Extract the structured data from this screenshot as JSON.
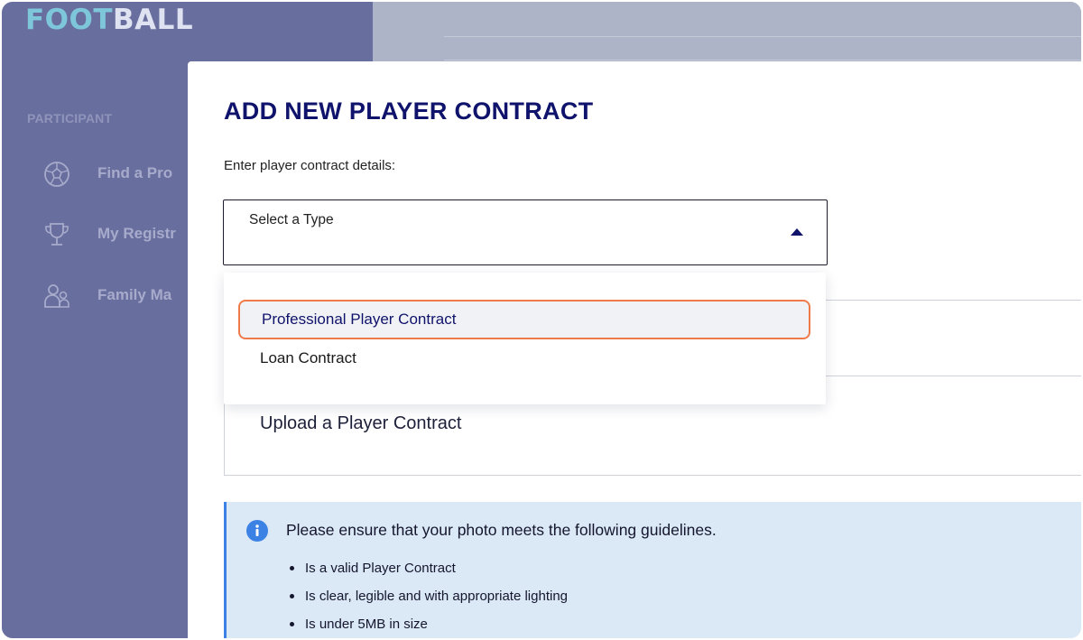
{
  "logo": {
    "part1": "FOOT",
    "part2": "BALL"
  },
  "sidebar": {
    "section_label": "PARTICIPANT",
    "items": [
      {
        "label": "Find a Pro",
        "icon": "soccer-ball-icon"
      },
      {
        "label": "My Registr",
        "icon": "trophy-icon"
      },
      {
        "label": "Family Ma",
        "icon": "family-icon"
      }
    ]
  },
  "modal": {
    "title": "ADD NEW PLAYER CONTRACT",
    "subtitle": "Enter player contract details:",
    "type_select": {
      "placeholder": "Select a Type",
      "options": [
        "Professional Player Contract",
        "Loan Contract"
      ],
      "highlighted": "Professional Player Contract"
    },
    "upload_label": "Upload a Player Contract",
    "guidelines": {
      "heading": "Please ensure that your photo meets the following guidelines.",
      "items": [
        "Is a valid Player Contract",
        "Is clear, legible and with appropriate lighting",
        "Is under 5MB in size"
      ]
    }
  },
  "colors": {
    "title": "#10136b",
    "highlight_border": "#ef7a4a",
    "info_background": "#dbe8f6",
    "info_accent": "#3b82e4",
    "sidebar": "#686e9e"
  }
}
